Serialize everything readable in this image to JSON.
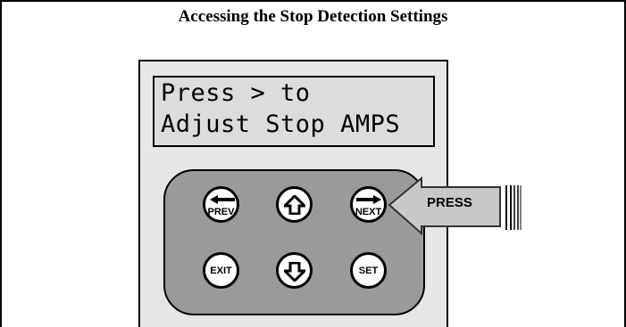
{
  "title": "Accessing the Stop Detection Settings",
  "lcd": {
    "line1": "Press > to",
    "line2": "Adjust Stop AMPS"
  },
  "keys": {
    "prev": "PREV",
    "up": "",
    "next": "NEXT",
    "exit": "EXIT",
    "down": "",
    "set": "SET"
  },
  "callout": {
    "label": "PRESS"
  },
  "colors": {
    "panel": "#e6e6e6",
    "lcd": "#dcdcdc",
    "keypad": "#9a9a9a",
    "callout": "#c8c8c8"
  },
  "icons": [
    "left-arrow-icon",
    "up-arrow-icon",
    "right-arrow-icon",
    "down-arrow-icon"
  ]
}
